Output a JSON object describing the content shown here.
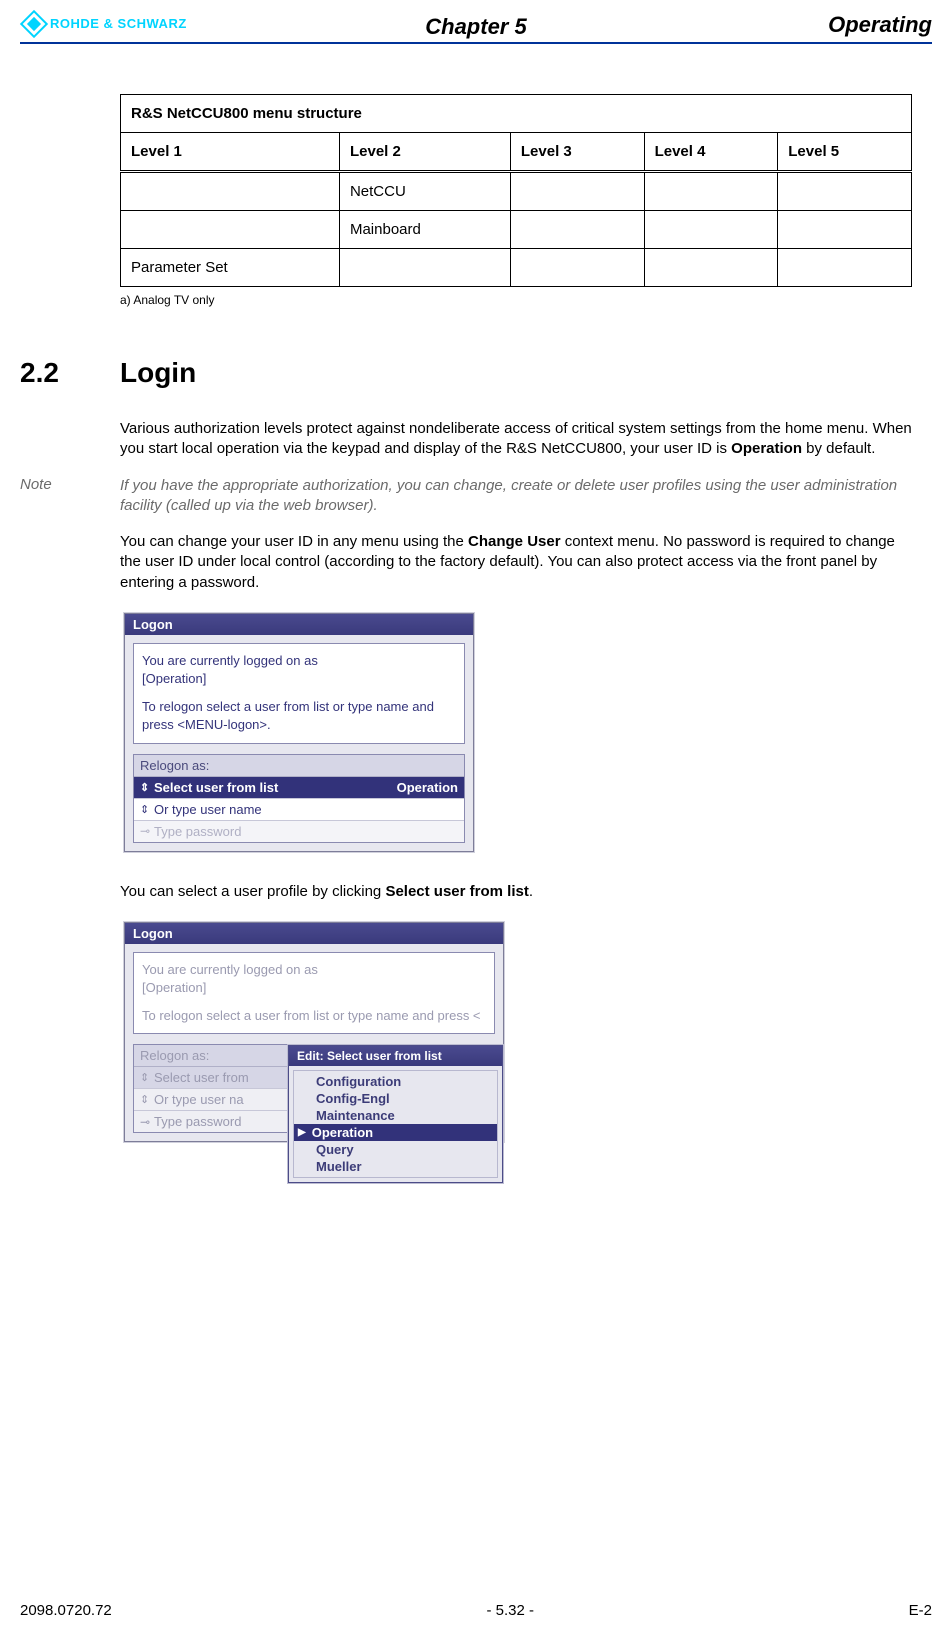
{
  "header": {
    "logo_text": "ROHDE & SCHWARZ",
    "chapter": "Chapter 5",
    "section_title": "Operating"
  },
  "table": {
    "title": "R&S NetCCU800 menu structure",
    "levels": [
      "Level 1",
      "Level 2",
      "Level 3",
      "Level 4",
      "Level 5"
    ],
    "rows": [
      {
        "c1": "",
        "c2": "NetCCU",
        "c3": "",
        "c4": "",
        "c5": ""
      },
      {
        "c1": "",
        "c2": "Mainboard",
        "c3": "",
        "c4": "",
        "c5": ""
      },
      {
        "c1": "Parameter Set",
        "c2": "",
        "c3": "",
        "c4": "",
        "c5": ""
      }
    ],
    "footnote": "a)   Analog TV only"
  },
  "section": {
    "number": "2.2",
    "title": "Login",
    "p1a": "Various authorization levels protect against nondeliberate access of critical system settings from the home menu. When you start local operation via the keypad and display of the R&S NetCCU800, your user ID is ",
    "p1b": "Operation",
    "p1c": " by default.",
    "note_label": "Note",
    "note_text": "If you have the appropriate authorization, you can change, create or delete user profiles using the user administration facility (called up via the web browser).",
    "p2a": "You can change your user ID in any menu using the ",
    "p2b": "Change User",
    "p2c": " context menu. No password is required to change the user ID under local control (according to the factory default). You can also protect access via the front panel by entering a password.",
    "p3a": "You can select a user profile by clicking ",
    "p3b": "Select user from list",
    "p3c": "."
  },
  "logon1": {
    "title": "Logon",
    "info1": "You are currently logged on as",
    "info2": "[Operation]",
    "info3": "To relogon select a user from list or type name and press <MENU-logon>.",
    "relogon_hd": "Relogon as:",
    "row1_lbl": "Select user from list",
    "row1_val": "Operation",
    "row2_lbl": "Or type user name",
    "row3_lbl": "Type password"
  },
  "logon2": {
    "title": "Logon",
    "info1": "You are currently logged on as",
    "info2": "[Operation]",
    "info3": "To relogon select a user from list or type name and press <",
    "relogon_hd": "Relogon as:",
    "row1_lbl": "Select user from",
    "row2_lbl": "Or type user na",
    "row3_lbl": "Type password",
    "popup_title": "Edit:  Select user from list",
    "popup_items": [
      "Configuration",
      "Config-Engl",
      "Maintenance",
      "Operation",
      "Query",
      "Mueller"
    ],
    "popup_selected": "Operation"
  },
  "footer": {
    "left": "2098.0720.72",
    "center": "- 5.32 -",
    "right": "E-2"
  }
}
